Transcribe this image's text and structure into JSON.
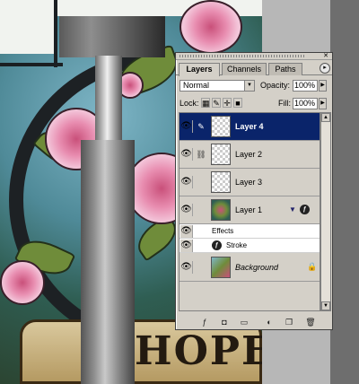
{
  "palette": {
    "close_glyph": "✕",
    "tabs": [
      {
        "label": "Layers",
        "active": true
      },
      {
        "label": "Channels",
        "active": false
      },
      {
        "label": "Paths",
        "active": false
      }
    ],
    "menu_glyph": "▸",
    "blend_mode": "Normal",
    "opacity_label": "Opacity:",
    "opacity_value": "100%",
    "lock_label": "Lock:",
    "fill_label": "Fill:",
    "fill_value": "100%",
    "layers": [
      {
        "name": "Layer 4",
        "selected": true,
        "thumb": "transparent",
        "linked": "brush"
      },
      {
        "name": "Layer 2",
        "selected": false,
        "thumb": "transparent",
        "linked": "link"
      },
      {
        "name": "Layer 3",
        "selected": false,
        "thumb": "transparent",
        "linked": ""
      },
      {
        "name": "Layer 1",
        "selected": false,
        "thumb": "art",
        "linked": "",
        "has_effects": true
      },
      {
        "name": "Background",
        "selected": false,
        "thumb": "bg",
        "linked": "",
        "locked": true
      }
    ],
    "effects_label": "Effects",
    "stroke_label": "Stroke",
    "fx_glyph": "ƒ",
    "eye_glyph": "👁",
    "lock_glyph": "🔒",
    "footer_icons": [
      "layer-style-icon",
      "mask-icon",
      "new-set-icon",
      "adjustment-layer-icon",
      "new-layer-icon",
      "trash-icon"
    ]
  },
  "canvas": {
    "banner_text": "HOPE"
  }
}
